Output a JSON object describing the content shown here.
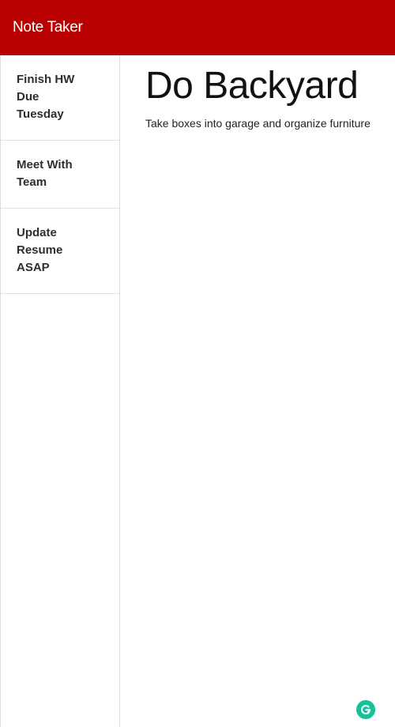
{
  "app": {
    "title": "Note Taker"
  },
  "notes": [
    {
      "title": "Finish HW Due Tuesday"
    },
    {
      "title": "Meet With Team"
    },
    {
      "title": "Update Resume ASAP"
    }
  ],
  "active_note": {
    "title": "Do Backyard",
    "text": "Take boxes into garage and organize furniture"
  },
  "extension": {
    "icon": "grammarly-icon",
    "color": "#15c39a"
  },
  "colors": {
    "navbar": "#b80000"
  }
}
